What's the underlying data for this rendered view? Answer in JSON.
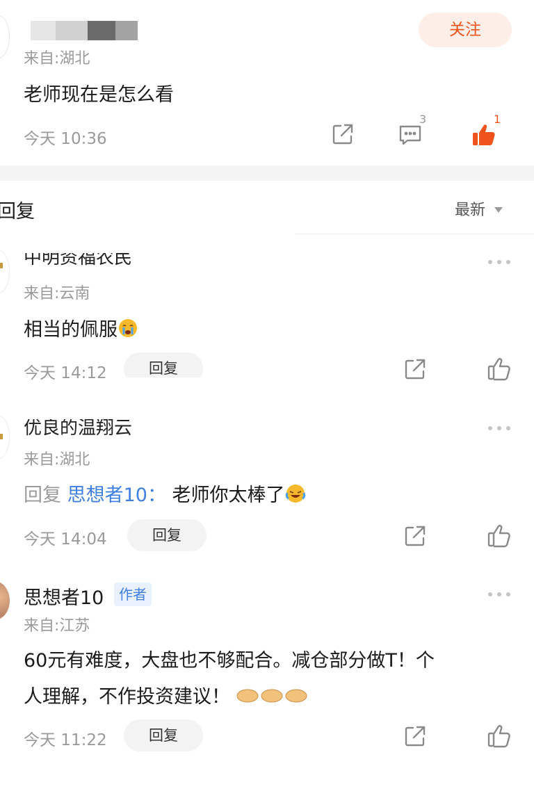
{
  "top_comment": {
    "follow_label": "关注",
    "location": "来自:湖北",
    "text": "老师现在是怎么看",
    "time": "今天 10:36",
    "comment_count": "3",
    "like_count": "1"
  },
  "replies_header": {
    "title": "回复",
    "sort_label": "最新"
  },
  "replies": [
    {
      "partial_name": "中明资福农民",
      "location": "来自:云南",
      "text": "相当的佩服",
      "time": "今天 14:12",
      "reply_label": "回复"
    },
    {
      "partial_name": "优良的温翔云",
      "location": "来自:湖北",
      "reply_prefix": "回复",
      "mention": "思想者10",
      "colon": "：",
      "text": "老师你太棒了",
      "time": "今天 14:04",
      "reply_label": "回复"
    },
    {
      "name": "思想者10",
      "badge": "作者",
      "location": "来自:江苏",
      "text_line1": "60元有难度，大盘也不够配合。减仓部分做T！个",
      "text_line2": "人理解，不作投资建议！",
      "time": "今天 11:22",
      "reply_label": "回复"
    }
  ],
  "colors": {
    "accent_orange": "#f0531c",
    "follow_bg": "#fdeee7",
    "link_blue": "#3f7fe0",
    "badge_bg": "#e9f1fd"
  }
}
